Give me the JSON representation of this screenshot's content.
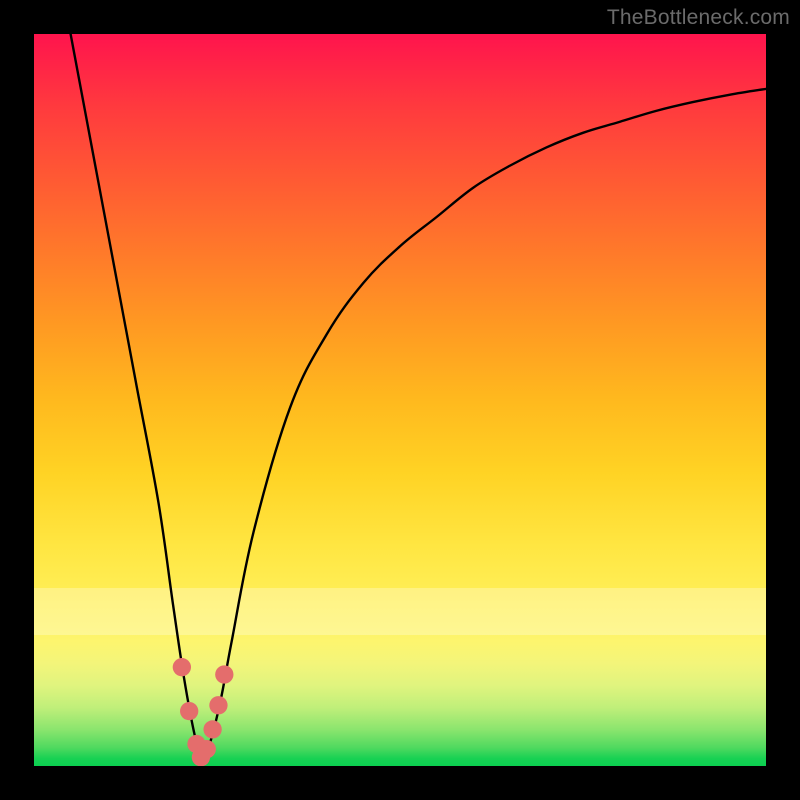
{
  "watermark": "TheBottleneck.com",
  "colors": {
    "frame": "#000000",
    "curve": "#000000",
    "markers": "#e46d6c",
    "gradient_top": "#ff144d",
    "gradient_bottom": "#0bcf50"
  },
  "chart_data": {
    "type": "line",
    "title": "",
    "xlabel": "",
    "ylabel": "",
    "xlim": [
      0,
      100
    ],
    "ylim": [
      0,
      100
    ],
    "note": "Axes are implicit percentages of the plot area; no tick labels are rendered. Lower y = bottom (green), higher y = top (red). Curve dips to y≈0 near x≈23.",
    "series": [
      {
        "name": "bottleneck-curve",
        "x": [
          5,
          8,
          11,
          14,
          17,
          19,
          20.5,
          22,
          23,
          24,
          25.5,
          27,
          30,
          35,
          40,
          45,
          50,
          55,
          60,
          65,
          70,
          75,
          80,
          85,
          90,
          95,
          100
        ],
        "y": [
          100,
          84,
          68,
          52,
          36,
          22,
          12,
          4,
          1,
          3,
          9,
          17,
          32,
          49,
          59,
          66,
          71,
          75,
          79,
          82,
          84.5,
          86.5,
          88,
          89.5,
          90.7,
          91.7,
          92.5
        ]
      }
    ],
    "markers": {
      "name": "optimal-range",
      "x": [
        20.2,
        21.2,
        22.2,
        22.8,
        23.6,
        24.4,
        25.2,
        26.0
      ],
      "y": [
        13.5,
        7.5,
        3.0,
        1.2,
        2.3,
        5.0,
        8.3,
        12.5
      ],
      "r_pct": 1.25
    }
  }
}
